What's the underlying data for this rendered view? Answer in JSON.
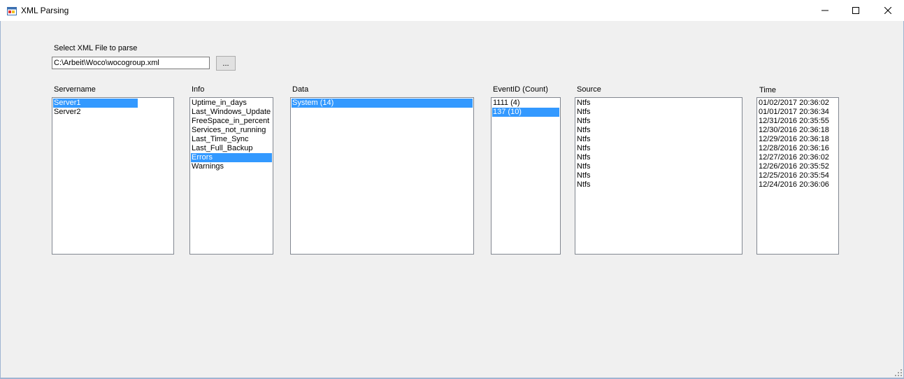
{
  "window": {
    "title": "XML Parsing",
    "minimize_glyph": "—",
    "maximize_glyph": "☐",
    "close_glyph": "✕"
  },
  "file": {
    "label": "Select XML File to parse",
    "path": "C:\\Arbeit\\Woco\\wocogroup.xml",
    "browse_label": "..."
  },
  "lists": {
    "servername": {
      "label": "Servername",
      "items": [
        {
          "text": "Server1",
          "selected": true
        },
        {
          "text": "Server2",
          "selected": false
        }
      ]
    },
    "info": {
      "label": "Info",
      "items": [
        {
          "text": "Uptime_in_days",
          "selected": false
        },
        {
          "text": "Last_Windows_Update",
          "selected": false
        },
        {
          "text": "FreeSpace_in_percent",
          "selected": false
        },
        {
          "text": "Services_not_running",
          "selected": false
        },
        {
          "text": "Last_Time_Sync",
          "selected": false
        },
        {
          "text": "Last_Full_Backup",
          "selected": false
        },
        {
          "text": "Errors",
          "selected": true
        },
        {
          "text": "Warnings",
          "selected": false
        }
      ]
    },
    "data": {
      "label": "Data",
      "items": [
        {
          "text": "System (14)",
          "selected": true
        }
      ]
    },
    "eventid": {
      "label": "EventID (Count)",
      "items": [
        {
          "text": "1111 (4)",
          "selected": false
        },
        {
          "text": "137 (10)",
          "selected": true
        }
      ]
    },
    "source": {
      "label": "Source",
      "items": [
        {
          "text": "Ntfs",
          "selected": false
        },
        {
          "text": "Ntfs",
          "selected": false
        },
        {
          "text": "Ntfs",
          "selected": false
        },
        {
          "text": "Ntfs",
          "selected": false
        },
        {
          "text": "Ntfs",
          "selected": false
        },
        {
          "text": "Ntfs",
          "selected": false
        },
        {
          "text": "Ntfs",
          "selected": false
        },
        {
          "text": "Ntfs",
          "selected": false
        },
        {
          "text": "Ntfs",
          "selected": false
        },
        {
          "text": "Ntfs",
          "selected": false
        }
      ]
    },
    "time": {
      "label": "Time",
      "items": [
        {
          "text": "01/02/2017 20:36:02",
          "selected": false
        },
        {
          "text": "01/01/2017 20:36:34",
          "selected": false
        },
        {
          "text": "12/31/2016 20:35:55",
          "selected": false
        },
        {
          "text": "12/30/2016 20:36:18",
          "selected": false
        },
        {
          "text": "12/29/2016 20:36:18",
          "selected": false
        },
        {
          "text": "12/28/2016 20:36:16",
          "selected": false
        },
        {
          "text": "12/27/2016 20:36:02",
          "selected": false
        },
        {
          "text": "12/26/2016 20:35:52",
          "selected": false
        },
        {
          "text": "12/25/2016 20:35:54",
          "selected": false
        },
        {
          "text": "12/24/2016 20:36:06",
          "selected": false
        }
      ]
    }
  },
  "colors": {
    "selection": "#3399ff",
    "client_bg": "#f0f0f0",
    "listbox_border": "#828790"
  }
}
